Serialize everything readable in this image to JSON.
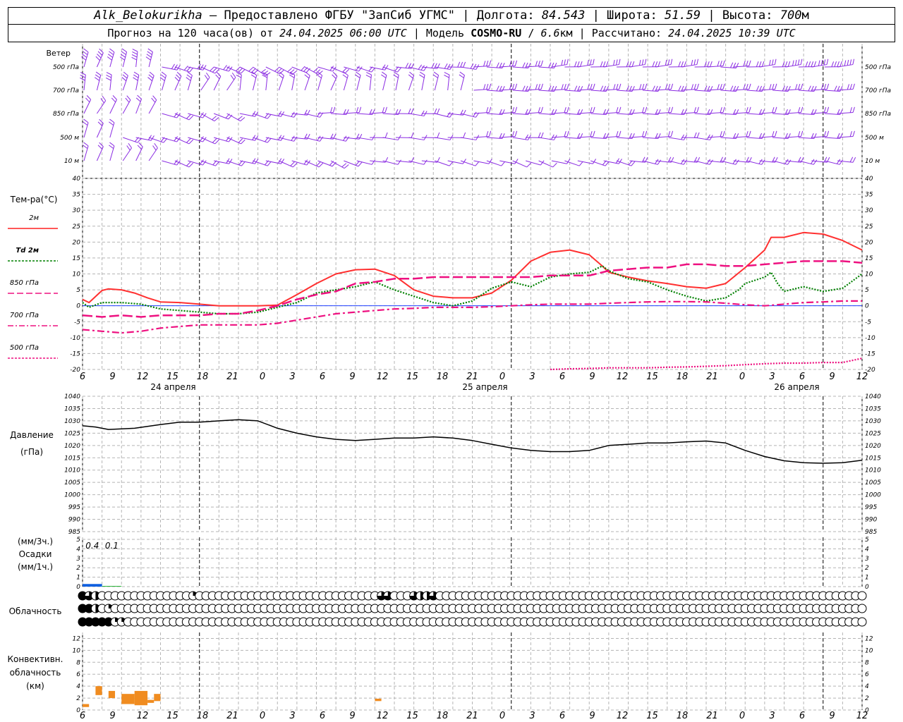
{
  "header": {
    "station": "Alk_Belokurikha",
    "provided_by": "Предоставлено ФГБУ \"ЗапСиб УГМС\"",
    "lon_label": "Долгота:",
    "lon_value": "84.543",
    "lat_label": "Широта:",
    "lat_value": "51.59",
    "alt_label": "Высота:",
    "alt_value": "700",
    "alt_unit": "м",
    "forecast_label": "Прогноз на 120 часа(ов) от",
    "forecast_start": "24.04.2025 06:00 UTC",
    "model_label": "Модель",
    "model_name": "COSMO-RU",
    "model_res": "6.6",
    "model_res_unit": "км",
    "calc_label": "Рассчитано:",
    "calc_time": "24.04.2025 10:39 UTC"
  },
  "wind": {
    "title": "Ветер",
    "levels": [
      "500 гПа",
      "700 гПа",
      "850 гПа",
      "500 м",
      "10  м"
    ]
  },
  "hour_ticks": [
    "6",
    "9",
    "12",
    "15",
    "18",
    "21",
    "0",
    "3",
    "6",
    "9",
    "12",
    "15",
    "18",
    "21",
    "0",
    "3",
    "6",
    "9",
    "12",
    "15",
    "18",
    "21",
    "0",
    "3",
    "6",
    "9",
    "12"
  ],
  "day_labels": [
    "24 апреля",
    "25 апреля",
    "26 апреля"
  ],
  "temperature": {
    "title": "Тем-ра(°С)",
    "legend": [
      {
        "label": "2м",
        "color": "#ff2020",
        "style": "solid"
      },
      {
        "label": "Td  2м",
        "color": "#008000",
        "style": "dotted"
      },
      {
        "label": "850 гПа",
        "color": "#ee1080",
        "style": "dashed"
      },
      {
        "label": "700 гПа",
        "color": "#ee1080",
        "style": "dashdot"
      },
      {
        "label": "500 гПа",
        "color": "#ee1080",
        "style": "dotted"
      }
    ],
    "ticks": [
      "40",
      "35",
      "30",
      "25",
      "20",
      "15",
      "10",
      "5",
      "0",
      "-5",
      "-10",
      "-15",
      "-20"
    ]
  },
  "pressure": {
    "title": "Давление",
    "unit": "(гПа)",
    "ticks": [
      "1040",
      "1035",
      "1030",
      "1025",
      "1020",
      "1015",
      "1010",
      "1005",
      "1000",
      "995",
      "990",
      "985"
    ]
  },
  "precip": {
    "unit_top": "(мм/3ч.)",
    "title": "Осадки",
    "unit_bottom": "(мм/1ч.)",
    "ticks": [
      "5",
      "4",
      "3",
      "2",
      "1",
      "0"
    ],
    "labels": [
      "0.4",
      "0.1"
    ]
  },
  "cloud": {
    "title": "Облачность"
  },
  "conv": {
    "title1": "Конвективн.",
    "title2": "облачность",
    "unit": "(км)",
    "ticks": [
      "12",
      "10",
      "8",
      "6",
      "4",
      "2",
      "0"
    ]
  },
  "chart_data": {
    "type": "line",
    "x_unit": "hours from 24.04.2025 06:00 UTC",
    "series": [
      {
        "name": "2м",
        "x": [
          0,
          1,
          3,
          4,
          6,
          8,
          10,
          12,
          15,
          18,
          21,
          24,
          27,
          30,
          33,
          36,
          39,
          42,
          45,
          48,
          51,
          54,
          57,
          60,
          63,
          66,
          69,
          72,
          75,
          78,
          80,
          81,
          84,
          87,
          90,
          93,
          96,
          99,
          102,
          105,
          106,
          108,
          111,
          114,
          117,
          120
        ],
        "values": [
          2,
          1,
          4.8,
          5.3,
          5,
          4,
          2.5,
          1.2,
          1,
          0.5,
          0,
          0,
          0,
          0.2,
          3.5,
          7,
          10,
          11.3,
          11.5,
          9.5,
          5,
          3,
          2.5,
          2.5,
          4,
          8,
          14,
          16.8,
          17.5,
          16,
          12.5,
          10.5,
          9,
          7.8,
          7,
          6,
          5.5,
          7,
          12,
          17.5,
          21.5,
          21.5,
          23,
          22.5,
          20.5,
          17.5
        ]
      },
      {
        "name": "Td  2м",
        "x": [
          0,
          1,
          3,
          6,
          9,
          12,
          15,
          18,
          21,
          24,
          27,
          30,
          33,
          36,
          39,
          42,
          45,
          48,
          51,
          54,
          57,
          60,
          63,
          66,
          69,
          72,
          75,
          78,
          80,
          81,
          84,
          87,
          90,
          93,
          96,
          99,
          101,
          102,
          105,
          106,
          107,
          108,
          111,
          114,
          117,
          120
        ],
        "values": [
          1,
          -0.5,
          1,
          1,
          0.5,
          -1,
          -1.5,
          -2,
          -2.5,
          -2.5,
          -2,
          -0.5,
          1,
          4,
          5,
          6,
          7.5,
          5,
          3,
          1,
          0,
          1.5,
          5.5,
          7.5,
          6,
          9,
          10,
          10.5,
          12.5,
          11,
          8.5,
          7.5,
          5,
          3,
          1.5,
          2.5,
          5,
          7,
          9,
          10.5,
          7,
          4.5,
          6,
          4.5,
          5.5,
          10
        ]
      },
      {
        "name": "850 гПа",
        "x": [
          0,
          3,
          6,
          9,
          12,
          15,
          18,
          21,
          24,
          27,
          30,
          33,
          36,
          39,
          42,
          45,
          48,
          51,
          54,
          57,
          60,
          63,
          66,
          69,
          72,
          75,
          78,
          81,
          84,
          87,
          90,
          93,
          96,
          99,
          102,
          105,
          108,
          111,
          114,
          117,
          120
        ],
        "values": [
          -3,
          -3.5,
          -3,
          -3.5,
          -3,
          -3,
          -3,
          -2.5,
          -2.5,
          -1.5,
          0,
          2,
          3.5,
          4.5,
          7,
          7.5,
          8.5,
          8.5,
          9,
          9,
          9,
          9,
          9,
          9,
          9.5,
          9.5,
          9.5,
          11,
          11.5,
          12,
          12,
          13,
          13,
          12.5,
          12.5,
          13,
          13.5,
          14,
          14,
          14,
          13.5
        ]
      },
      {
        "name": "700 гПа",
        "x": [
          0,
          3,
          6,
          9,
          12,
          15,
          18,
          21,
          24,
          27,
          30,
          33,
          36,
          39,
          42,
          45,
          48,
          51,
          54,
          57,
          60,
          63,
          66,
          69,
          72,
          75,
          78,
          81,
          84,
          87,
          90,
          93,
          96,
          99,
          102,
          105,
          108,
          111,
          114,
          117,
          120
        ],
        "values": [
          -7.5,
          -8,
          -8.5,
          -8,
          -7,
          -6.5,
          -6,
          -6,
          -6,
          -6,
          -5.5,
          -4.5,
          -3.5,
          -2.5,
          -2,
          -1.5,
          -1,
          -0.8,
          -0.5,
          -0.5,
          -0.5,
          -0.3,
          0,
          0.3,
          0.5,
          0.5,
          0.5,
          0.8,
          1,
          1.2,
          1.3,
          1.3,
          1.2,
          0.8,
          0.3,
          0,
          0.5,
          1,
          1.2,
          1.5,
          1.5
        ]
      },
      {
        "name": "500 гПа",
        "x": [
          72,
          75,
          78,
          81,
          84,
          87,
          90,
          93,
          96,
          99,
          102,
          105,
          108,
          111,
          114,
          117,
          120
        ],
        "values": [
          -20,
          -19.8,
          -19.7,
          -19.5,
          -19.5,
          -19.5,
          -19.3,
          -19.2,
          -19,
          -18.8,
          -18.5,
          -18.2,
          -18,
          -18,
          -17.8,
          -17.8,
          -16.5
        ]
      },
      {
        "name": "Давление",
        "x": [
          0,
          2,
          4,
          8,
          12,
          15,
          18,
          21,
          24,
          27,
          30,
          33,
          36,
          39,
          42,
          45,
          48,
          51,
          54,
          57,
          60,
          63,
          66,
          69,
          72,
          75,
          78,
          81,
          84,
          87,
          90,
          93,
          96,
          99,
          102,
          105,
          108,
          111,
          114,
          117,
          120
        ],
        "values": [
          1028,
          1027.5,
          1026.5,
          1027,
          1028.5,
          1029.5,
          1029.5,
          1030,
          1030.5,
          1030,
          1027,
          1025,
          1023.5,
          1022.5,
          1022,
          1022.5,
          1023,
          1023,
          1023.5,
          1023,
          1022,
          1020.5,
          1019,
          1018,
          1017.5,
          1017.5,
          1018,
          1020,
          1020.5,
          1021,
          1021,
          1021.5,
          1021.8,
          1021,
          1018,
          1015.5,
          1013.8,
          1013,
          1012.8,
          1013,
          1014
        ]
      }
    ],
    "precip_bars": [
      {
        "x_start": 0,
        "x_end": 3,
        "mm": 0.4,
        "color": "#1060e0"
      },
      {
        "x_start": 3,
        "x_end": 6,
        "mm": 0.1,
        "color": "#20b030"
      }
    ],
    "cloud_rows": [
      {
        "level": "upper",
        "okta": [
          8,
          6,
          4,
          0,
          0,
          0,
          0,
          0,
          0,
          0,
          0,
          0,
          0,
          0,
          0,
          0,
          0,
          2,
          0,
          0,
          0,
          0,
          0,
          0,
          0,
          0,
          0,
          0,
          0,
          0,
          0,
          0,
          0,
          0,
          0,
          0,
          0,
          0,
          0,
          0,
          0,
          0,
          0,
          0,
          0,
          0,
          6,
          6,
          0,
          0,
          0,
          6,
          4,
          4,
          6,
          0,
          0,
          0,
          0,
          0,
          0,
          0,
          0,
          0,
          0,
          0,
          0,
          0,
          0,
          0,
          0,
          0,
          0,
          0,
          0,
          0,
          0,
          0,
          0,
          0,
          0,
          0,
          0,
          0,
          0,
          0,
          0,
          0,
          0,
          0,
          0,
          0,
          0,
          0,
          0,
          0,
          0,
          0,
          0,
          0,
          0,
          0,
          0,
          0,
          0,
          0,
          0,
          0,
          0,
          0,
          0,
          0,
          0,
          0,
          0,
          0,
          0,
          0,
          0,
          0,
          0
        ]
      },
      {
        "level": "middle",
        "okta": [
          8,
          8,
          4,
          0,
          2,
          0,
          0,
          0,
          0,
          0,
          0,
          0,
          0,
          0,
          0,
          0,
          0,
          0,
          0,
          0,
          0,
          0,
          0,
          0,
          0,
          0,
          0,
          0,
          0,
          0,
          0,
          0,
          0,
          0,
          0,
          0,
          0,
          0,
          0,
          0,
          0,
          0,
          0,
          0,
          0,
          0,
          0,
          0,
          0,
          0,
          0,
          0,
          0,
          0,
          0,
          0,
          0,
          0,
          0,
          0,
          0,
          0,
          0,
          0,
          0,
          0,
          0,
          0,
          0,
          0,
          0,
          0,
          0,
          0,
          0,
          0,
          0,
          0,
          0,
          0,
          0,
          0,
          0,
          0,
          0,
          0,
          0,
          0,
          0,
          0,
          0,
          0,
          0,
          0,
          0,
          0,
          0,
          0,
          0,
          0,
          0,
          0,
          0,
          0,
          0,
          0,
          0,
          0,
          0,
          0,
          0,
          0,
          0,
          0,
          0,
          0,
          0,
          0,
          0,
          0,
          0
        ]
      },
      {
        "level": "lower",
        "okta": [
          8,
          8,
          8,
          8,
          8,
          2,
          2,
          0,
          0,
          0,
          0,
          0,
          0,
          0,
          0,
          0,
          0,
          0,
          0,
          0,
          0,
          0,
          0,
          0,
          0,
          0,
          0,
          0,
          0,
          0,
          0,
          0,
          0,
          0,
          0,
          0,
          0,
          0,
          0,
          0,
          0,
          0,
          0,
          0,
          0,
          0,
          0,
          0,
          0,
          0,
          0,
          0,
          0,
          0,
          0,
          0,
          0,
          0,
          0,
          0,
          0,
          0,
          0,
          0,
          0,
          0,
          0,
          0,
          0,
          0,
          0,
          0,
          0,
          0,
          0,
          0,
          0,
          0,
          0,
          0,
          0,
          0,
          0,
          0,
          0,
          0,
          0,
          0,
          0,
          0,
          0,
          0,
          0,
          0,
          0,
          0,
          0,
          0,
          0,
          0,
          0,
          0,
          0,
          0,
          0,
          0,
          0,
          0,
          0,
          0,
          0,
          0,
          0,
          0,
          0,
          0,
          0,
          0,
          0,
          0,
          0
        ]
      }
    ],
    "conv_bars": [
      {
        "x_start": 0,
        "x_end": 1,
        "base_km": 0.5,
        "top_km": 1
      },
      {
        "x_start": 2,
        "x_end": 3,
        "base_km": 2.5,
        "top_km": 4
      },
      {
        "x_start": 4,
        "x_end": 5,
        "base_km": 2,
        "top_km": 3.2
      },
      {
        "x_start": 6,
        "x_end": 8,
        "base_km": 1,
        "top_km": 2.7
      },
      {
        "x_start": 8,
        "x_end": 10,
        "base_km": 0.8,
        "top_km": 3.2
      },
      {
        "x_start": 10,
        "x_end": 11,
        "base_km": 1.2,
        "top_km": 1.7
      },
      {
        "x_start": 11,
        "x_end": 12,
        "base_km": 1.5,
        "top_km": 2.7
      },
      {
        "x_start": 45,
        "x_end": 46,
        "base_km": 1.5,
        "top_km": 1.9
      }
    ],
    "t_ylim": [
      -20,
      40
    ],
    "p_ylim": [
      985,
      1040
    ],
    "precip_ylim": [
      0,
      5
    ],
    "conv_ylim": [
      0,
      13
    ]
  }
}
